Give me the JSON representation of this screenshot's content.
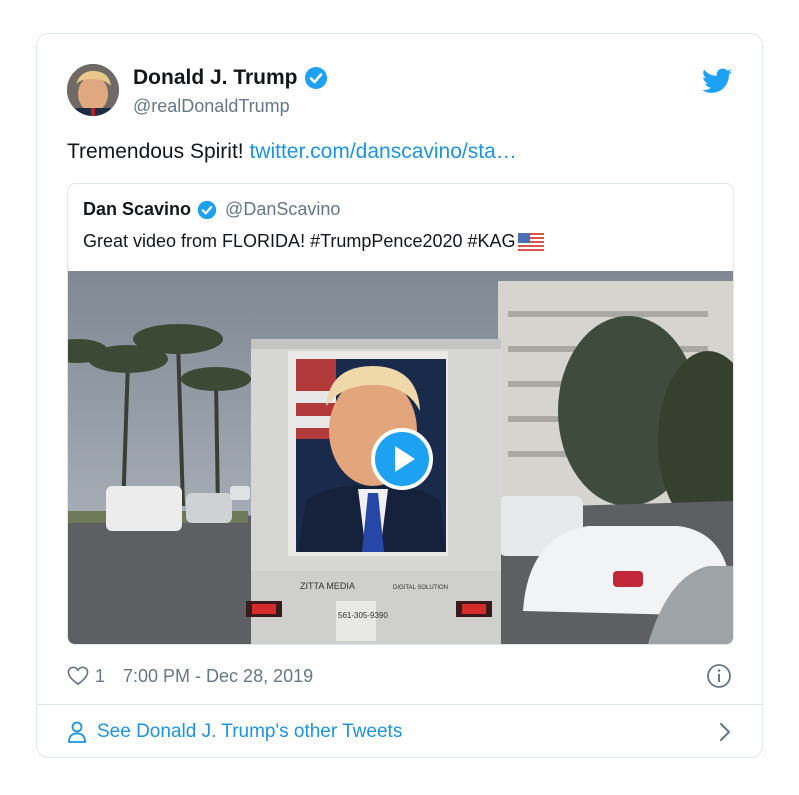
{
  "author": {
    "name": "Donald J. Trump",
    "handle": "@realDonaldTrump"
  },
  "tweet": {
    "text": "Tremendous Spirit! ",
    "link_text": "twitter.com/danscavino/sta…"
  },
  "quoted": {
    "name": "Dan Scavino",
    "handle": "@DanScavino",
    "text": "Great video from FLORIDA! #TrumpPence2020 #KAG"
  },
  "media": {
    "truck_brand": "ZITTA MEDIA",
    "truck_sub": "DIGITAL SOLUTION",
    "truck_phone": "561-305-9390"
  },
  "meta": {
    "likes": "1",
    "timestamp": "7:00 PM - Dec 28, 2019"
  },
  "footer": {
    "label": "See Donald J. Trump's other Tweets"
  },
  "colors": {
    "twitter_blue": "#1da1f2",
    "link_blue": "#1b95e0",
    "secondary_text": "#657786"
  },
  "icons": [
    "verified-icon",
    "twitter-bird-icon",
    "heart-icon",
    "info-icon",
    "person-icon",
    "chevron-right-icon",
    "play-icon",
    "us-flag-icon"
  ]
}
